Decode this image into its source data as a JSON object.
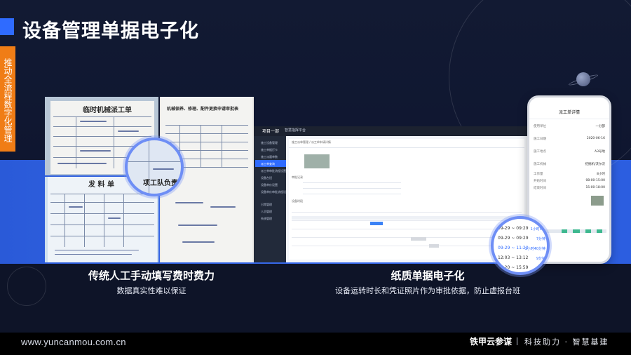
{
  "page": {
    "title": "设备管理单据电子化",
    "side_tab": "推动全流程数字化管理"
  },
  "left_panel": {
    "dispatch_sheet_title": "临时机械派工单",
    "repair_sheet_title": "机械保养、修理、配件更换申请审批表",
    "material_sheet_title": "发 料 单",
    "magnifier_text": "项工队负责",
    "caption_title": "传统人工手动填写费时费力",
    "caption_sub": "数据真实性难以保证"
  },
  "right_panel": {
    "webapp": {
      "brand": "项目一部",
      "platform": "智慧指挥平台",
      "breadcrumb": "施工派单管理  /  派工单申请详情",
      "menu": [
        "施工设备管理",
        "施工单据打卡",
        "施工派遣单数",
        "派工单查询",
        "派工单审批流程设置",
        "设备台班",
        "设备单价设置",
        "设备单价审批流程设置",
        "日常管理",
        "人员管理",
        "系统管理"
      ],
      "active_menu_index": 3,
      "section_label_1": "审批记录",
      "section_label_2": "设备时段"
    },
    "phone": {
      "title": "派工单详情",
      "rows": [
        {
          "label": "使用单位",
          "value": "一分部"
        },
        {
          "label": "施工日期",
          "value": "2020-06-16"
        },
        {
          "label": "施工地点",
          "value": "A3号地"
        },
        {
          "label": "施工机械",
          "value": "挖掘机/沃尔沃"
        },
        {
          "label": "工作量",
          "value": "8小时"
        },
        {
          "label": "开始时间",
          "value": "08:00-15:00"
        },
        {
          "label": "结束时间",
          "value": "15:00-18:00"
        }
      ]
    },
    "lens_rows": [
      {
        "time": "09-29 ~ 09:29",
        "tag": "1小时9分"
      },
      {
        "time": "09-29 ~ 09:29",
        "tag": "7分钟"
      },
      {
        "time": "09-29 ~ 11:20",
        "tag": "1小时40分钟"
      },
      {
        "time": "12:03 ~ 13:12",
        "tag": "9分钟"
      },
      {
        "time": "13:20 ~ 15:59",
        "tag": "2:40"
      }
    ],
    "caption_title": "纸质单据电子化",
    "caption_sub": "设备运转时长和凭证照片作为审批依据，防止虚报台班"
  },
  "footer": {
    "url": "www.yuncanmou.com.cn",
    "brand": "铁甲云参谋",
    "slogan": "科技助力 · 智慧基建"
  },
  "colors": {
    "accent_blue": "#2f6bff",
    "side_tab_orange": "#f07d16",
    "background": "#0d1326"
  }
}
